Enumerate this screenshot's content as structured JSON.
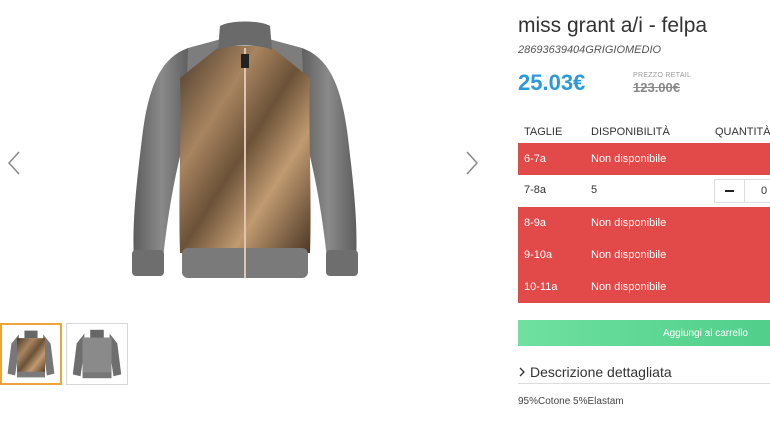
{
  "product": {
    "title": "miss grant a/i - felpa",
    "sku": "28693639404GRIGIOMEDIO",
    "price": "25.03€",
    "retail_label": "PREZZO RETAIL",
    "retail_price": "123.00€"
  },
  "sizes_table": {
    "headers": {
      "size": "TAGLIE",
      "availability": "DISPONIBILITÀ",
      "quantity": "QUANTITÀ"
    },
    "rows": [
      {
        "size": "6-7a",
        "availability": "Non disponibile"
      },
      {
        "size": "7-8a",
        "availability": "5",
        "quantity": "0"
      },
      {
        "size": "8-9a",
        "availability": "Non disponibile"
      },
      {
        "size": "9-10a",
        "availability": "Non disponibile"
      },
      {
        "size": "10-11a",
        "availability": "Non disponibile"
      }
    ]
  },
  "cart_button_label": "Aggiungi al carrello",
  "description": {
    "toggle_label": "Descrizione dettagliata",
    "composition": "95%Cotone 5%Elastam"
  },
  "gallery": {
    "thumbnails": [
      "front-view",
      "back-view"
    ],
    "active_thumbnail": 0
  },
  "colors": {
    "price": "#2b9ad8",
    "unavailable_row": "#e24a4a",
    "cart_button": "#4fcf89",
    "active_thumb_border": "#f0a23b"
  },
  "icons": {
    "prev": "chevron-left-icon",
    "next": "chevron-right-icon",
    "description": "chevron-right-icon",
    "stepper": "minus-icon"
  }
}
